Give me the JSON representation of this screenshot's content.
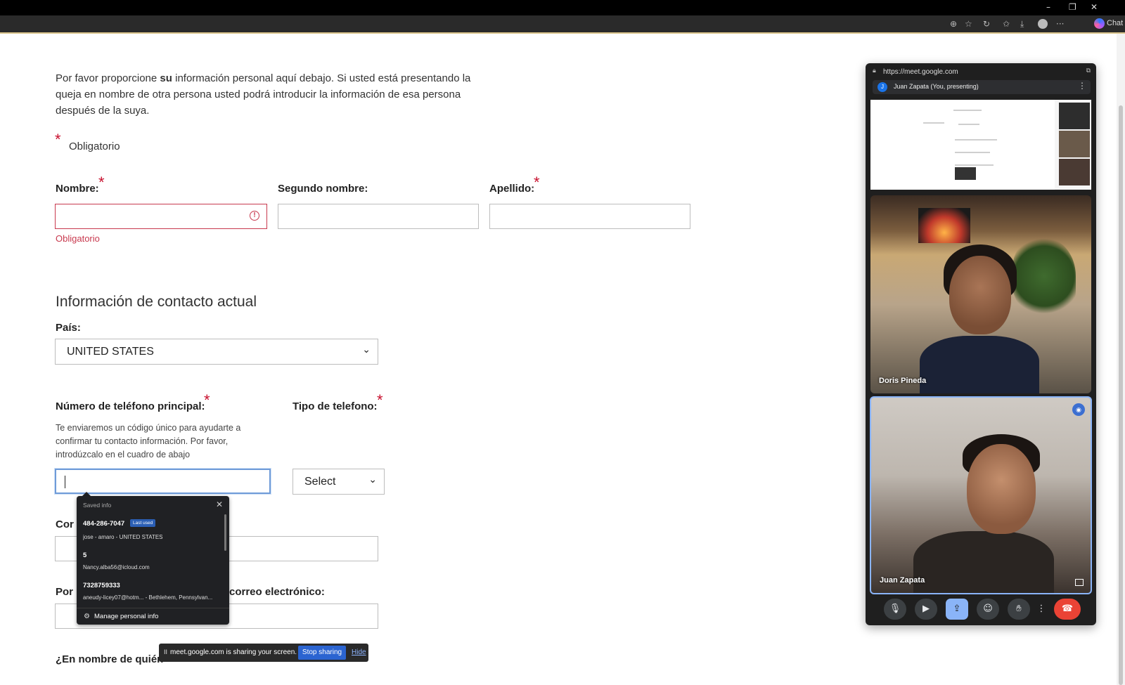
{
  "browser": {
    "window_controls": [
      "–",
      "❐",
      "✕"
    ],
    "toolbar_icons": [
      "zoom-icon",
      "star-icon",
      "refresh-icon",
      "favorites-icon",
      "download-icon",
      "profile-icon",
      "more-icon"
    ],
    "chat_label": "Chat"
  },
  "form": {
    "intro_pre": "Por favor proporcione ",
    "intro_bold": "su",
    "intro_post": " información personal aquí debajo. Si usted está presentando la queja en nombre de otra persona usted podrá introducir la información de esa persona después de la suya.",
    "required_star": "*",
    "required_legend": "Obligatorio",
    "labels": {
      "nombre": "Nombre:",
      "segundo_nombre": "Segundo nombre:",
      "apellido": "Apellido:",
      "pais": "País:",
      "telefono": "Número de teléfono principal:",
      "tipo_telefono": "Tipo de telefono:"
    },
    "error_text": "Obligatorio",
    "section_title": "Información de contacto actual",
    "pais_value": "UNITED STATES",
    "phone_help": "Te enviaremos un código único para ayudarte a confirmar tu contacto información. Por favor, introdúzcalo en el cuadro de abajo",
    "tipo_select_value": "Select",
    "clipped_labels": {
      "correo_left": "Cor",
      "por_left": "Por",
      "correo_right": "correo electrónico:",
      "en_nombre": "¿En nombre de quién"
    }
  },
  "autofill": {
    "header": "Saved info",
    "entries": [
      {
        "main": "484-286-7047",
        "badge": "Last used",
        "sub": "jose - amaro - UNITED STATES"
      },
      {
        "main": "5",
        "sub": "Nancy.alba56@icloud.com"
      },
      {
        "main": "7328759333",
        "sub": "aneudy-licey07@hotm... - Bethlehem, Pennsylvan..."
      }
    ],
    "manage": "Manage personal info"
  },
  "sharebar": {
    "text": "meet.google.com is sharing your screen.",
    "stop": "Stop sharing",
    "hide": "Hide"
  },
  "meet": {
    "url": "https://meet.google.com",
    "presenting_initial": "J",
    "presenting": "Juan Zapata (You, presenting)",
    "participants": [
      "Doris Pineda",
      "Juan Zapata"
    ],
    "controls": [
      "mic-icon",
      "camera-icon",
      "present-icon",
      "emoji-icon",
      "raise-hand-icon",
      "more-options-icon",
      "end-call-icon"
    ],
    "accent": "#8ab4f8",
    "end_color": "#ea4335"
  },
  "colors": {
    "required": "#c8102e",
    "error": "#c8394e",
    "focus": "#6f9bd8"
  }
}
